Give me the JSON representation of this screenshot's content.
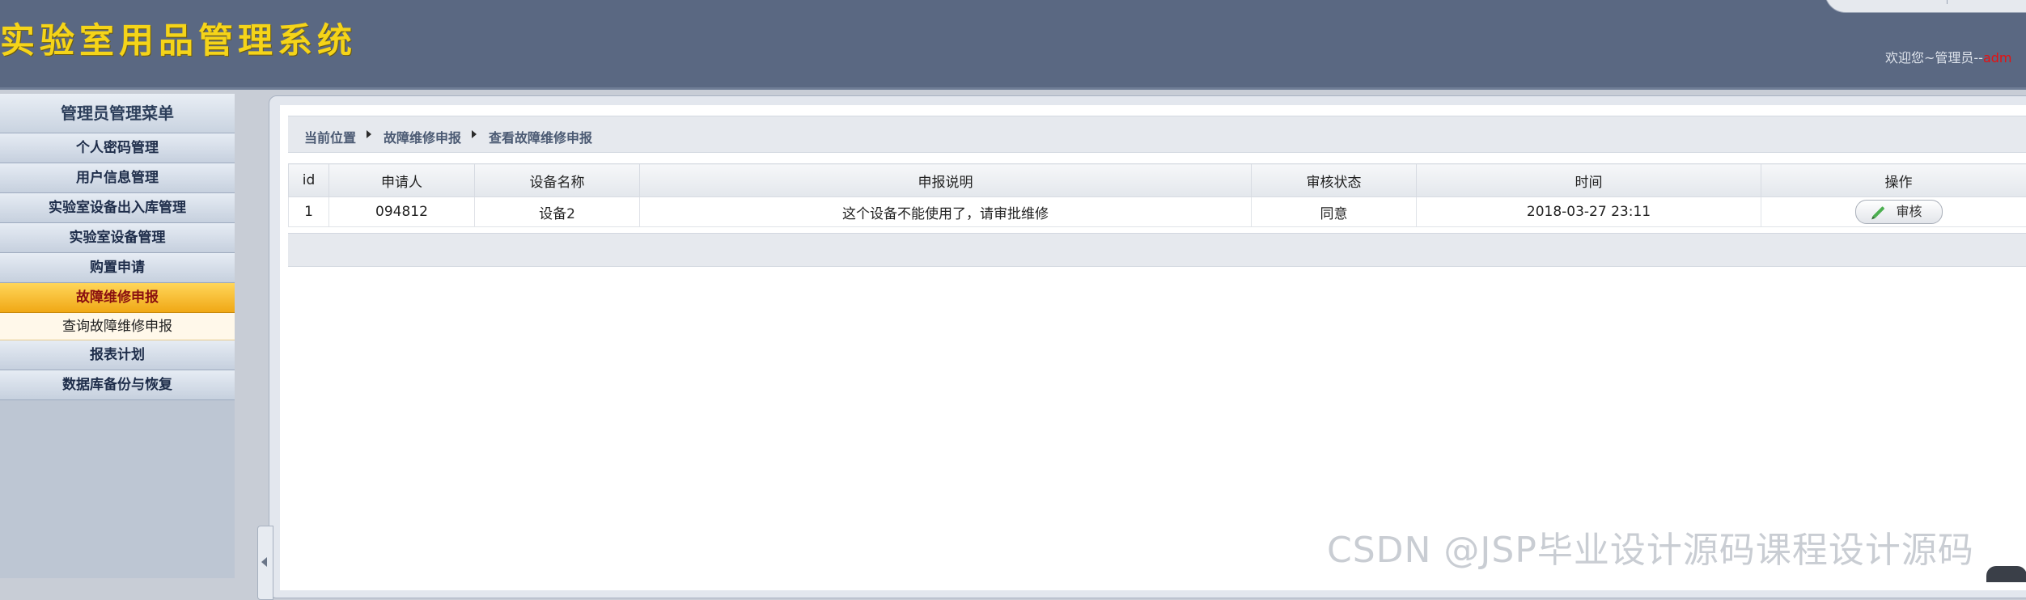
{
  "app": {
    "title": "实验室用品管理系统",
    "welcome_prefix": "欢迎您~管理员--",
    "welcome_user": "adm"
  },
  "sidebar": {
    "header": "管理员管理菜单",
    "items": [
      {
        "label": "个人密码管理"
      },
      {
        "label": "用户信息管理"
      },
      {
        "label": "实验室设备出入库管理"
      },
      {
        "label": "实验室设备管理"
      },
      {
        "label": "购置申请"
      },
      {
        "label": "故障维修申报",
        "active": true
      },
      {
        "label": "报表计划"
      },
      {
        "label": "数据库备份与恢复"
      }
    ],
    "active_sub": "查询故障维修申报"
  },
  "breadcrumb": [
    "当前位置",
    "故障维修申报",
    "查看故障维修申报"
  ],
  "table": {
    "columns": [
      "id",
      "申请人",
      "设备名称",
      "申报说明",
      "审核状态",
      "时间",
      "操作"
    ],
    "rows": [
      {
        "id": "1",
        "applicant": "094812",
        "device": "设备2",
        "description": "这个设备不能使用了，请审批维修",
        "status": "同意",
        "time": "2018-03-27 23:11",
        "action_label": "审核"
      }
    ]
  },
  "watermark": "CSDN @JSP毕业设计源码课程设计源码",
  "colors": {
    "header_bg": "#5a6882",
    "title_yellow": "#f5d419",
    "active_menu": "#f0a816",
    "active_text": "#8a1010"
  }
}
